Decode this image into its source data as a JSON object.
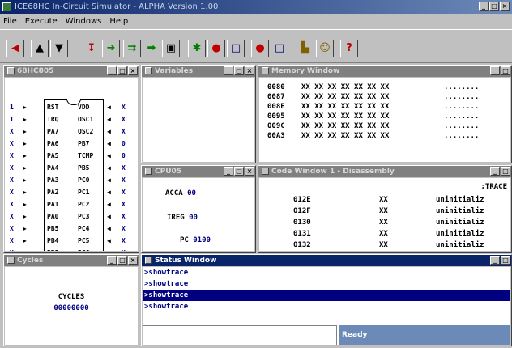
{
  "app": {
    "title": "ICE68HC In-Circuit Simulator - ALPHA Version 1.00",
    "menu": [
      "File",
      "Execute",
      "Windows",
      "Help"
    ]
  },
  "toolbar_icons": [
    "back-arrow",
    "load",
    "save",
    "step",
    "step-over",
    "multi-step",
    "run",
    "breakpoint",
    "go",
    "stop",
    "clear",
    "record",
    "page",
    "graph",
    "watch",
    "help"
  ],
  "mcu": {
    "title": "68HC805",
    "left_pins": [
      {
        "dir": "1",
        "label": "RST"
      },
      {
        "dir": "1",
        "label": "IRQ"
      },
      {
        "dir": "X",
        "label": "PA7"
      },
      {
        "dir": "X",
        "label": "PA6"
      },
      {
        "dir": "X",
        "label": "PA5"
      },
      {
        "dir": "X",
        "label": "PA4"
      },
      {
        "dir": "X",
        "label": "PA3"
      },
      {
        "dir": "X",
        "label": "PA2"
      },
      {
        "dir": "X",
        "label": "PA1"
      },
      {
        "dir": "X",
        "label": "PA0"
      },
      {
        "dir": "X",
        "label": "PB5"
      },
      {
        "dir": "X",
        "label": "PB4"
      },
      {
        "dir": "X",
        "label": "PB3"
      }
    ],
    "right_pins": [
      {
        "dir": "X",
        "label": "VDD"
      },
      {
        "dir": "X",
        "label": "OSC1"
      },
      {
        "dir": "X",
        "label": "OSC2"
      },
      {
        "dir": "0",
        "label": "PB7"
      },
      {
        "dir": "0",
        "label": "TCMP"
      },
      {
        "dir": "X",
        "label": "PB5"
      },
      {
        "dir": "X",
        "label": "PC0"
      },
      {
        "dir": "X",
        "label": "PC1"
      },
      {
        "dir": "X",
        "label": "PC2"
      },
      {
        "dir": "X",
        "label": "PC3"
      },
      {
        "dir": "X",
        "label": "PC4"
      },
      {
        "dir": "X",
        "label": "PC5"
      },
      {
        "dir": "X",
        "label": "PC6"
      }
    ]
  },
  "variables": {
    "title": "Variables"
  },
  "memory": {
    "title": "Memory Window",
    "rows": [
      {
        "addr": "0080",
        "bytes": "XX XX XX XX XX XX XX",
        "ascii": "........"
      },
      {
        "addr": "0087",
        "bytes": "XX XX XX XX XX XX XX",
        "ascii": "........"
      },
      {
        "addr": "008E",
        "bytes": "XX XX XX XX XX XX XX",
        "ascii": "........"
      },
      {
        "addr": "0095",
        "bytes": "XX XX XX XX XX XX XX",
        "ascii": "........"
      },
      {
        "addr": "009C",
        "bytes": "XX XX XX XX XX XX XX",
        "ascii": "........"
      },
      {
        "addr": "00A3",
        "bytes": "XX XX XX XX XX XX XX",
        "ascii": "........"
      }
    ]
  },
  "cpu": {
    "title": "CPU05",
    "regs": [
      {
        "name": "ACCA",
        "value": "00"
      },
      {
        "name": "IREG",
        "value": "00"
      },
      {
        "name": "PC",
        "value": "0100"
      }
    ]
  },
  "code": {
    "title": "Code Window 1 - Disassembly",
    "label": ";TRACE",
    "rows": [
      {
        "addr": "012E",
        "op": "XX",
        "text": "uninitializ"
      },
      {
        "addr": "012F",
        "op": "XX",
        "text": "uninitializ"
      },
      {
        "addr": "0130",
        "op": "XX",
        "text": "uninitializ"
      },
      {
        "addr": "0131",
        "op": "XX",
        "text": "uninitializ"
      },
      {
        "addr": "0132",
        "op": "XX",
        "text": "uninitializ"
      }
    ]
  },
  "cycles": {
    "title": "Cycles",
    "label": "CYCLES",
    "value": "00000000"
  },
  "status": {
    "title": "Status Window",
    "lines": [
      ">showtrace",
      ">showtrace",
      ">showtrace",
      ">showtrace"
    ],
    "selected_index": 2,
    "input_value": "",
    "ready": "Ready"
  }
}
